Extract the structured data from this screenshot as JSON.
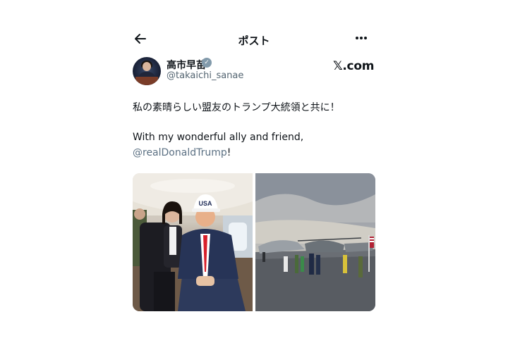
{
  "header": {
    "title": "ポスト",
    "back_icon": "arrow-left-icon",
    "more_icon": "more-horizontal-icon"
  },
  "author": {
    "name": "高市早苗",
    "handle": "@takaichi_sanae",
    "verified": true,
    "verified_color": "#829aab"
  },
  "watermark": "𝕏.com",
  "post": {
    "line1": "私の素晴らしい盟友のトランプ大統領と共に！",
    "line2": "With my wonderful ally and friend,",
    "mention": "@realDonaldTrump",
    "suffix": "!"
  },
  "photo_left": {
    "cap_text": "USA"
  },
  "colors": {
    "mention": "#5b7083",
    "handle": "#536471"
  }
}
